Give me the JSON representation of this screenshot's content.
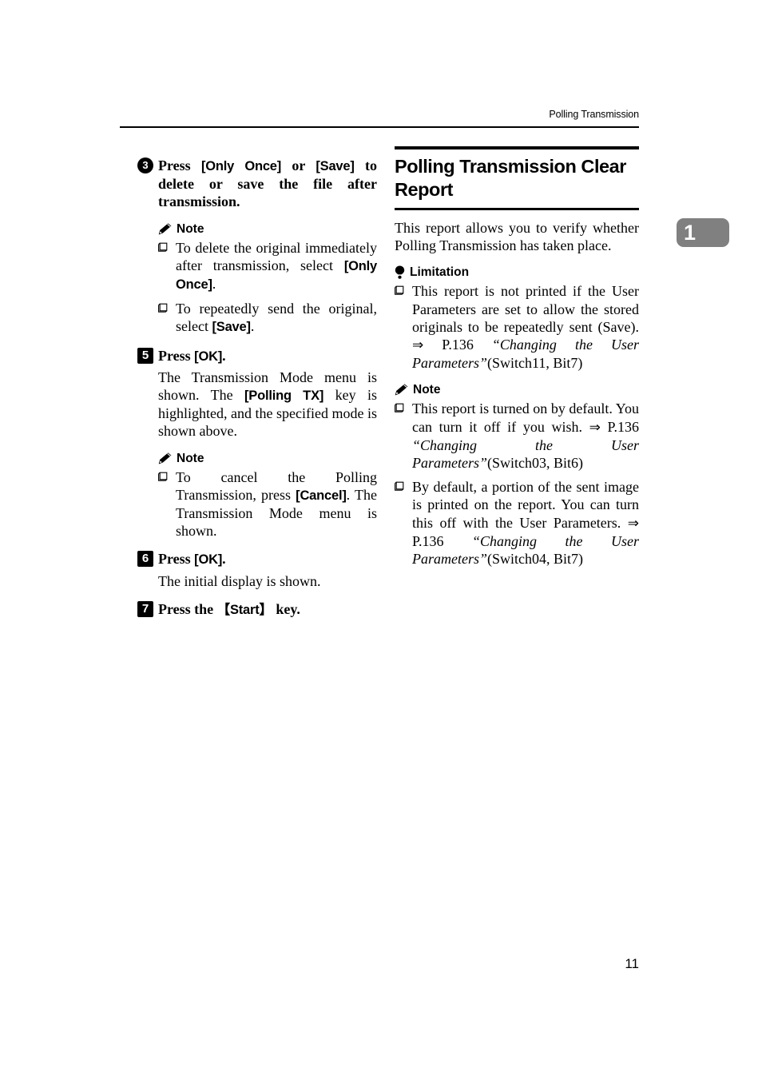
{
  "header": {
    "running_title": "Polling Transmission"
  },
  "chapter_tab": {
    "number": "1",
    "color": "#808080"
  },
  "page_number": "11",
  "left_column": {
    "step3": {
      "marker": "3",
      "marker_style": "circle",
      "text_parts": [
        "Press ",
        "[Only Once]",
        " or ",
        "[Save]",
        " to delete or save the file after transmission."
      ]
    },
    "note1": {
      "icon": "pencil-icon",
      "label": "Note",
      "bullets": [
        {
          "parts": [
            "To delete the original immediately after transmission, select ",
            "[Only Once]",
            "."
          ]
        },
        {
          "parts": [
            "To repeatedly send the original, select ",
            "[Save]",
            "."
          ]
        }
      ]
    },
    "step5": {
      "marker": "5",
      "marker_style": "square",
      "text_parts": [
        "Press ",
        "[OK]",
        "."
      ],
      "body_parts": [
        "The Transmission Mode menu is shown. The ",
        "[Polling TX]",
        " key is highlighted, and the specified mode is shown above."
      ]
    },
    "note2": {
      "icon": "pencil-icon",
      "label": "Note",
      "bullets": [
        {
          "parts": [
            "To cancel the Polling Transmission, press ",
            "[Cancel]",
            ". The Transmission Mode menu is shown."
          ]
        }
      ]
    },
    "step6": {
      "marker": "6",
      "marker_style": "square",
      "text_parts": [
        "Press ",
        "[OK]",
        "."
      ],
      "body": "The initial display is shown."
    },
    "step7": {
      "marker": "7",
      "marker_style": "square",
      "text_parts": [
        "Press the ",
        "【Start】",
        " key."
      ]
    }
  },
  "right_column": {
    "section_title": "Polling Transmission Clear Report",
    "lead": "This report allows you to verify whether Polling Transmission has taken place.",
    "limitation": {
      "icon": "bulb-icon",
      "label": "Limitation",
      "bullets": [
        {
          "text_1": "This report is not printed if the User Parameters are set to allow the stored originals to be repeatedly sent (Save). ",
          "arrow": "⇒",
          "text_2": " P.136 ",
          "ref": "“Changing the User Parameters”",
          "text_3": "(Switch11, Bit7)"
        }
      ]
    },
    "note": {
      "icon": "pencil-icon",
      "label": "Note",
      "bullets": [
        {
          "text_1": "This report is turned on by default. You can turn it off if you wish. ",
          "arrow": "⇒",
          "text_2": " P.136 ",
          "ref": "“Changing the User Parameters”",
          "text_3": "(Switch03, Bit6)"
        },
        {
          "text_1": "By default, a portion of the sent image is printed on the report. You can turn this off with the User Parameters. ",
          "arrow": "⇒",
          "text_2": " P.136 ",
          "ref": "“Changing the User Parameters”",
          "text_3": "(Switch04, Bit7)"
        }
      ]
    }
  }
}
